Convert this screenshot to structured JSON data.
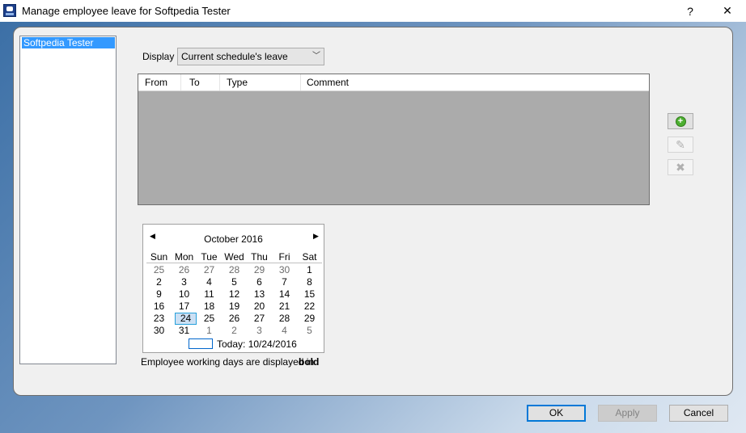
{
  "window": {
    "title": "Manage employee leave for Softpedia Tester",
    "help_glyph": "?",
    "close_glyph": "✕"
  },
  "employees": [
    "Softpedia Tester"
  ],
  "display": {
    "label": "Display",
    "selected": "Current schedule's leave"
  },
  "grid": {
    "columns": [
      "From",
      "To",
      "Type",
      "Comment"
    ]
  },
  "side_buttons": {
    "add_icon": "add-icon",
    "edit_icon": "pencil-icon",
    "delete_icon": "delete-icon"
  },
  "calendar": {
    "month_title": "October 2016",
    "day_names": [
      "Sun",
      "Mon",
      "Tue",
      "Wed",
      "Thu",
      "Fri",
      "Sat"
    ],
    "weeks": [
      [
        "25",
        "26",
        "27",
        "28",
        "29",
        "30",
        "1"
      ],
      [
        "2",
        "3",
        "4",
        "5",
        "6",
        "7",
        "8"
      ],
      [
        "9",
        "10",
        "11",
        "12",
        "13",
        "14",
        "15"
      ],
      [
        "16",
        "17",
        "18",
        "19",
        "20",
        "21",
        "22"
      ],
      [
        "23",
        "24",
        "25",
        "26",
        "27",
        "28",
        "29"
      ],
      [
        "30",
        "31",
        "1",
        "2",
        "3",
        "4",
        "5"
      ]
    ],
    "selected_day": "24",
    "today_label": "Today: 10/24/2016"
  },
  "note": {
    "text": "Employee working days are displayed in",
    "bold": "bold"
  },
  "buttons": {
    "ok": "OK",
    "apply": "Apply",
    "cancel": "Cancel"
  }
}
